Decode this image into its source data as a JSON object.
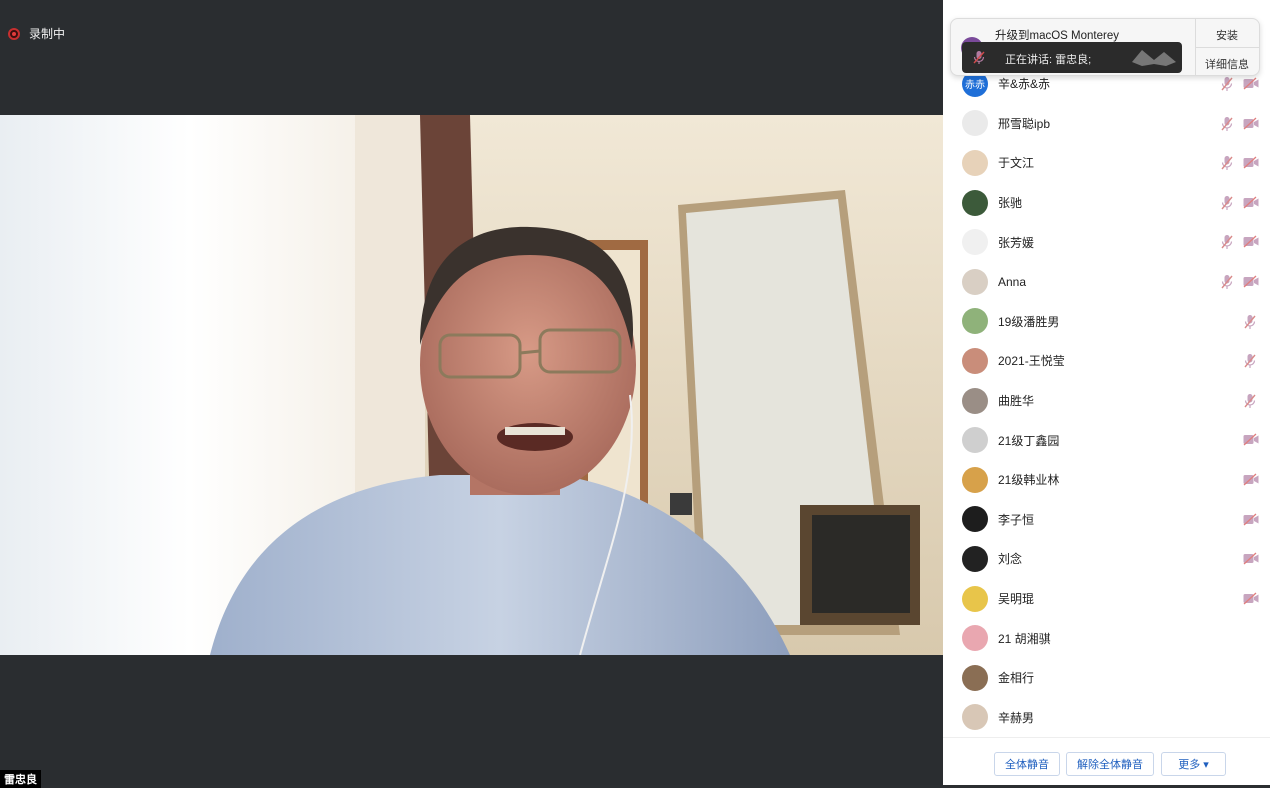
{
  "recording": {
    "label": "录制中"
  },
  "speaker": {
    "name": "雷忠良"
  },
  "notification": {
    "title": "升级到macOS Monterey",
    "install_label": "安装",
    "details_label": "详细信息",
    "speaking_text": "正在讲话: 雷忠良;"
  },
  "participants": [
    {
      "name": "辛&赤&赤",
      "avatar_text": "赤赤",
      "avatar_color": "#1f6fd8",
      "mic_muted": true,
      "camera_off": true
    },
    {
      "name": "邢雪聪ipb",
      "avatar_text": "",
      "avatar_color": "#eaeaea",
      "mic_muted": true,
      "camera_off": true
    },
    {
      "name": "于文江",
      "avatar_text": "",
      "avatar_color": "#e7d2b9",
      "mic_muted": true,
      "camera_off": true
    },
    {
      "name": "张驰",
      "avatar_text": "",
      "avatar_color": "#3c5a3a",
      "mic_muted": true,
      "camera_off": true
    },
    {
      "name": "张芳媛",
      "avatar_text": "",
      "avatar_color": "#f0f0f0",
      "mic_muted": true,
      "camera_off": true
    },
    {
      "name": "Anna",
      "avatar_text": "",
      "avatar_color": "#d9cfc4",
      "mic_muted": true,
      "camera_off": true
    },
    {
      "name": "19级潘胜男",
      "avatar_text": "",
      "avatar_color": "#8fb27a",
      "mic_muted": true,
      "camera_off": false
    },
    {
      "name": "2021-王悦莹",
      "avatar_text": "",
      "avatar_color": "#c98d7a",
      "mic_muted": true,
      "camera_off": false
    },
    {
      "name": "曲胜华",
      "avatar_text": "",
      "avatar_color": "#9a8e86",
      "mic_muted": true,
      "camera_off": false
    },
    {
      "name": "21级丁鑫园",
      "avatar_text": "",
      "avatar_color": "#cfcfcf",
      "mic_muted": false,
      "camera_off": true
    },
    {
      "name": "21级韩业林",
      "avatar_text": "",
      "avatar_color": "#d7a14a",
      "mic_muted": false,
      "camera_off": true
    },
    {
      "name": "李子恒",
      "avatar_text": "",
      "avatar_color": "#1d1d1d",
      "mic_muted": false,
      "camera_off": true
    },
    {
      "name": "刘念",
      "avatar_text": "",
      "avatar_color": "#222222",
      "mic_muted": false,
      "camera_off": true
    },
    {
      "name": "吴明琨",
      "avatar_text": "",
      "avatar_color": "#e8c54a",
      "mic_muted": false,
      "camera_off": true
    },
    {
      "name": "21 胡湘骐",
      "avatar_text": "",
      "avatar_color": "#e9a7b0",
      "mic_muted": false,
      "camera_off": false
    },
    {
      "name": "金相行",
      "avatar_text": "",
      "avatar_color": "#8a6e54",
      "mic_muted": false,
      "camera_off": false
    },
    {
      "name": "辛赫男",
      "avatar_text": "",
      "avatar_color": "#d8c7b6",
      "mic_muted": false,
      "camera_off": false
    }
  ],
  "footer": {
    "mute_all_label": "全体静音",
    "unmute_all_label": "解除全体静音",
    "more_label": "更多 ▾"
  }
}
